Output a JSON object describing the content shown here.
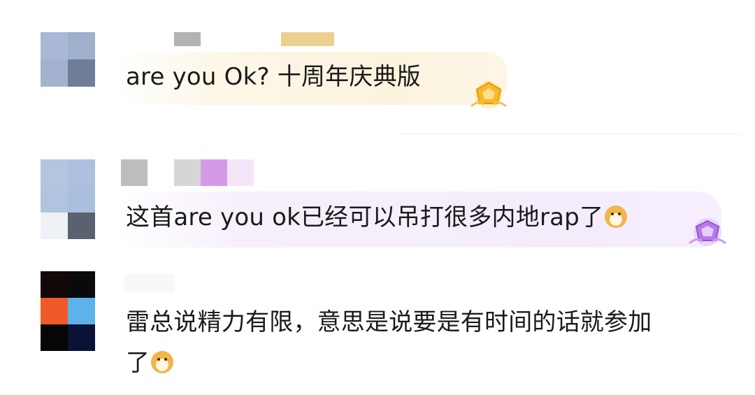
{
  "comments": [
    {
      "text": "are you Ok? 十周年庆典版",
      "badge": "gold-crown-badge"
    },
    {
      "text": "这首are you ok已经可以吊打很多内地rap了",
      "badge": "purple-diamond-badge",
      "emoji": "doge"
    },
    {
      "line1": "雷总说精力有限，意思是说要是有时间的话就参加",
      "line2": "了",
      "emoji": "doge"
    }
  ],
  "colors": {
    "gold_bubble": "#fdf6e4",
    "purple_bubble": "#f6effc",
    "text": "#1a1a1a"
  }
}
